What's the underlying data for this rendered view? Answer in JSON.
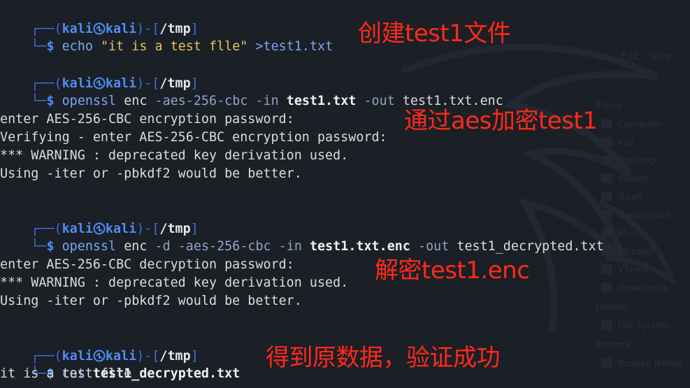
{
  "prompt": {
    "user": "kali",
    "host": "kali",
    "cwd": "/tmp",
    "symbol": "$"
  },
  "blocks": [
    {
      "command": "echo",
      "tokens": [
        "\"it is a test flle\"",
        ">test1.txt"
      ],
      "output": []
    },
    {
      "command": "openssl",
      "tokens": [
        "enc",
        "-aes-256-cbc",
        "-in",
        "test1.txt",
        "-out",
        "test1.txt.enc"
      ],
      "output": [
        "",
        "enter AES-256-CBC encryption password:",
        "Verifying - enter AES-256-CBC encryption password:",
        "*** WARNING : deprecated key derivation used.",
        "Using -iter or -pbkdf2 would be better."
      ]
    },
    {
      "command": "openssl",
      "tokens": [
        "enc",
        "-d",
        "-aes-256-cbc",
        "-in",
        "test1.txt.enc",
        "-out",
        "test1_decrypted.txt"
      ],
      "output": [
        "",
        "enter AES-256-CBC decryption password:",
        "*** WARNING : deprecated key derivation used.",
        "Using -iter or -pbkdf2 would be better."
      ]
    },
    {
      "command": "cat",
      "tokens": [
        "test1_decrypted.txt"
      ],
      "output": [
        "it is a test flle"
      ]
    }
  ],
  "annotations": [
    "创建test1文件",
    "通过aes加密test1",
    "解密test1.enc",
    "得到原数据，验证成功"
  ],
  "background_panel": {
    "places_header": "Places",
    "places": [
      "Computer",
      "kali",
      "Desktop",
      "Recent",
      "Trash",
      "Documents",
      "Music",
      "Pictures",
      "Videos",
      "Downloads"
    ],
    "devices_header": "Devices",
    "devices": [
      "File System"
    ],
    "network_header": "Network",
    "network": [
      "Browse Netwo"
    ],
    "toolbar": [
      "Go",
      "Edit",
      "View"
    ]
  },
  "colors": {
    "background": "#1b1f26",
    "prompt_frame": "#3d6fd6",
    "prompt_user": "#4f8df5",
    "annotation_red": "#ff2a1a"
  }
}
